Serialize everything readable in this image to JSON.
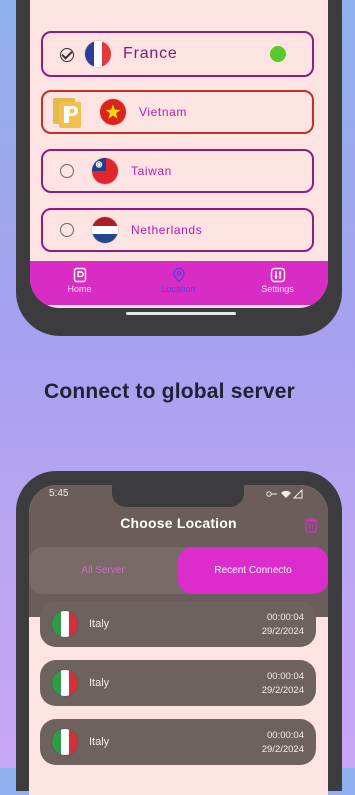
{
  "server_list": {
    "items": [
      {
        "name": "France",
        "checked": true,
        "connected": true,
        "status_color": "#59c92c"
      },
      {
        "name": "Vietnam",
        "checked": false,
        "ad": true
      },
      {
        "name": "Taiwan",
        "checked": false
      },
      {
        "name": "Netherlands",
        "checked": false
      }
    ]
  },
  "nav": {
    "home": "Home",
    "location": "Location",
    "settings": "Settings",
    "active": "location"
  },
  "caption": "Connect to global server",
  "phone2": {
    "status_time": "5:45",
    "title": "Choose Location",
    "tabs": {
      "all": "All Server",
      "recent": "Recent Connecto",
      "active": "recent"
    },
    "recent": [
      {
        "country": "Italy",
        "duration": "00:00:04",
        "date": "29/2/2024"
      },
      {
        "country": "Italy",
        "duration": "00:00:04",
        "date": "29/2/2024"
      },
      {
        "country": "Italy",
        "duration": "00:00:04",
        "date": "29/2/2024"
      }
    ]
  },
  "colors": {
    "accent": "#dc2ccb",
    "row_border": "#8c1f7e",
    "screen_bg": "#fde3e1",
    "header_bg": "#6b5d5b"
  }
}
